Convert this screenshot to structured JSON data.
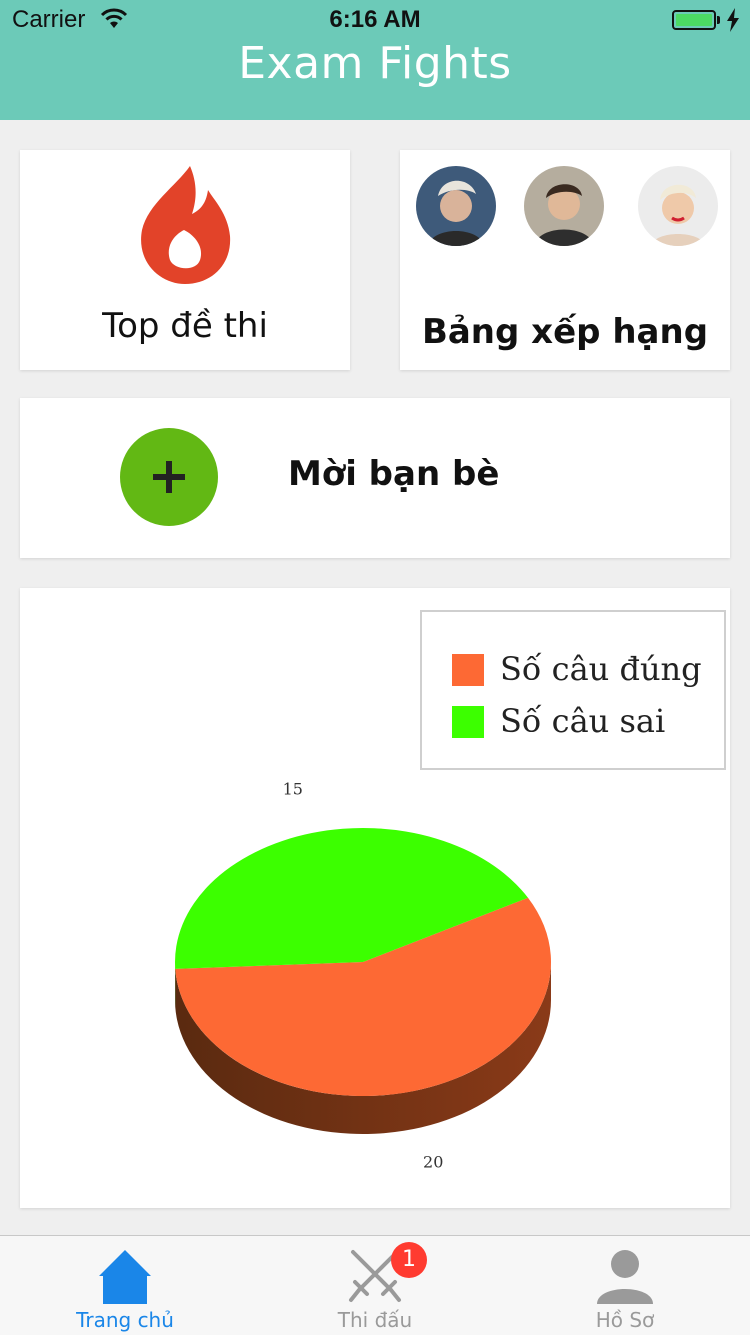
{
  "status": {
    "carrier": "Carrier",
    "time": "6:16 AM"
  },
  "app": {
    "title": "Exam Fights"
  },
  "cards": {
    "top_exams": {
      "label": "Top đề thi"
    },
    "leaderboard": {
      "label": "Bảng xếp hạng"
    },
    "invite": {
      "label": "Mời bạn bè"
    }
  },
  "chart_data": {
    "type": "pie",
    "categories": [
      "Số câu đúng",
      "Số câu sai"
    ],
    "values": [
      20,
      15
    ],
    "colors": [
      "#fd6934",
      "#3cff00"
    ],
    "legend": "top-right",
    "data_labels": [
      "20",
      "15"
    ]
  },
  "tabs": [
    {
      "label": "Trang chủ",
      "icon": "home-icon",
      "active": true
    },
    {
      "label": "Thi đấu",
      "icon": "crossed-swords-icon",
      "badge": "1"
    },
    {
      "label": "Hồ Sơ",
      "icon": "user-icon"
    }
  ],
  "colors": {
    "accent": "#6ccab8",
    "tab_active": "#1a86e8",
    "plus": "#62b814",
    "badge": "#ff3b30"
  }
}
